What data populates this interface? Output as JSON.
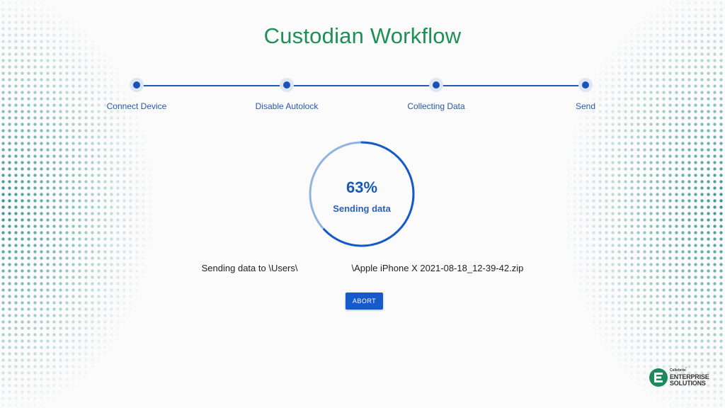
{
  "title": "Custodian Workflow",
  "steps": [
    {
      "label": "Connect Device"
    },
    {
      "label": "Disable Autolock"
    },
    {
      "label": "Collecting Data"
    },
    {
      "label": "Send"
    }
  ],
  "progress": {
    "percent_text": "63%",
    "value": 0.63,
    "status": "Sending data"
  },
  "send_path": {
    "prefix": "Sending data to \\Users\\",
    "suffix": "\\Apple iPhone X 2021-08-18_12-39-42.zip"
  },
  "abort_label": "ABORT",
  "logo": {
    "small": "Cellebrite",
    "line1": "ENTERPRISE",
    "line2": "SOLUTIONS",
    "star": "*"
  },
  "colors": {
    "title": "#1e9055",
    "accent": "#1659c9",
    "halftone": "#2a8f8a"
  }
}
